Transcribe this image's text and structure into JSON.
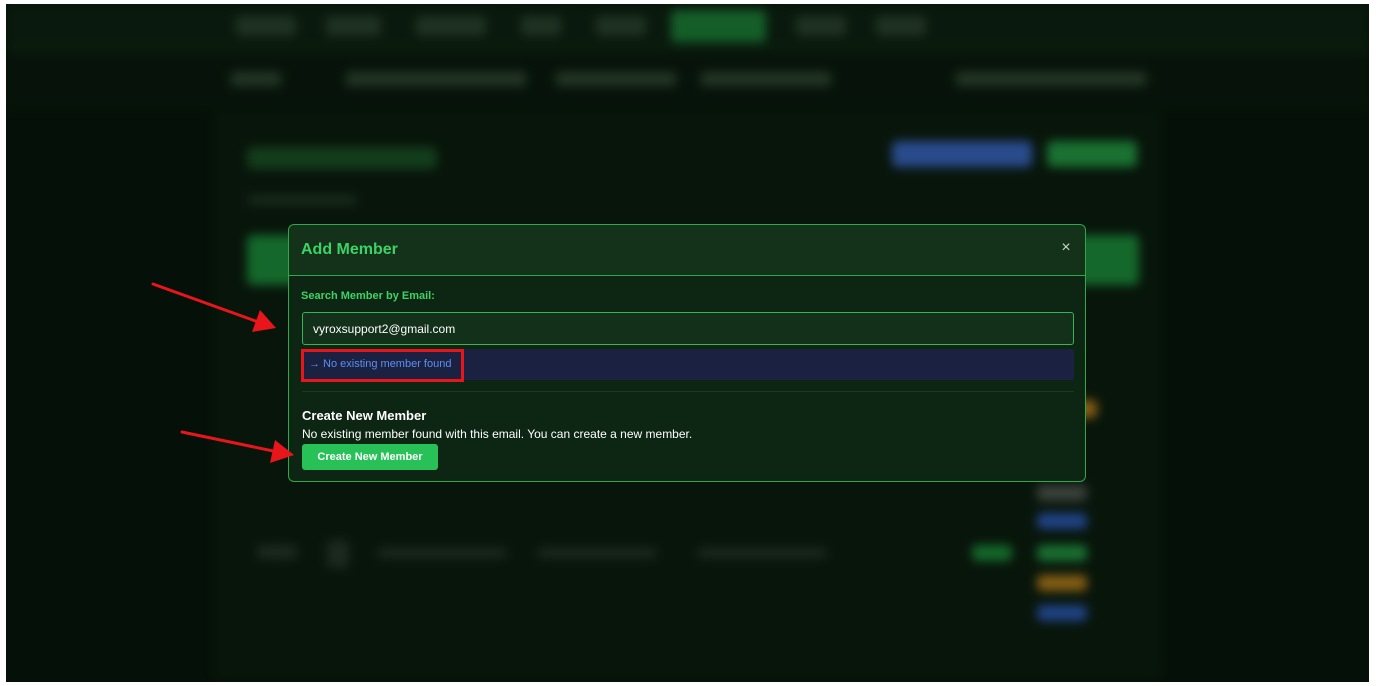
{
  "modal": {
    "title": "Add Member",
    "close_glyph": "×",
    "search_label": "Search Member by Email:",
    "search_value": "vyroxsupport2@gmail.com",
    "result_text": "→ No existing member found",
    "create_section": {
      "title": "Create New Member",
      "description": "No existing member found with this email. You can create a new member.",
      "button_label": "Create New Member"
    }
  },
  "annotations": {
    "arrow_color": "#e8161b",
    "highlight_color": "#e8161b"
  },
  "colors": {
    "accent_green": "#3ed266",
    "button_green": "#27c157",
    "link_blue": "#5e8ff0",
    "background_dark": "#081a0c"
  }
}
